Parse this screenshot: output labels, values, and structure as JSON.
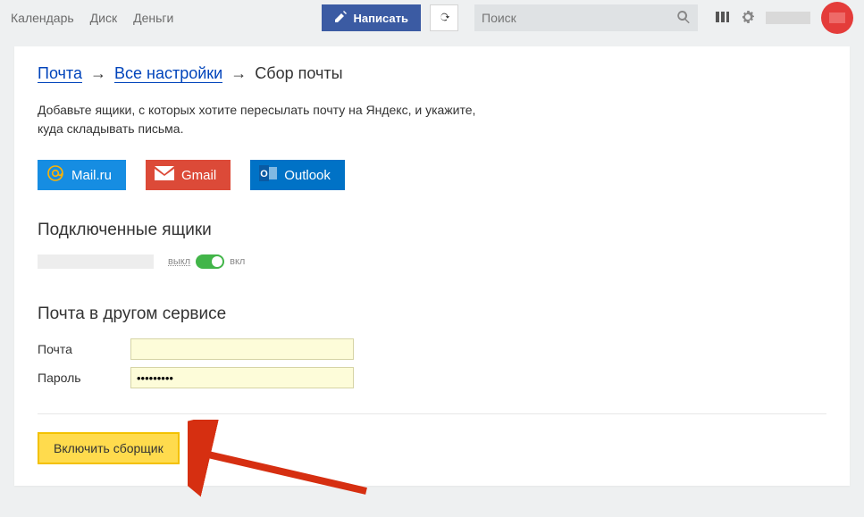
{
  "topbar": {
    "nav": [
      {
        "label": "Календарь"
      },
      {
        "label": "Диск"
      },
      {
        "label": "Деньги"
      }
    ],
    "compose_label": "Написать",
    "search_placeholder": "Поиск"
  },
  "breadcrumb": {
    "mail": "Почта",
    "arrow": "→",
    "all_settings": "Все настройки",
    "current": "Сбор почты"
  },
  "description": "Добавьте ящики, с которых хотите пересылать почту на Яндекс, и укажите,\nкуда складывать письма.",
  "providers": {
    "mailru": "Mail.ru",
    "gmail": "Gmail",
    "outlook": "Outlook"
  },
  "connected": {
    "title": "Подключенные ящики",
    "toggle_off": "выкл",
    "toggle_on": "вкл"
  },
  "other_service": {
    "title": "Почта в другом сервисе",
    "email_label": "Почта",
    "password_label": "Пароль",
    "password_value": "•••••••••"
  },
  "submit_label": "Включить сборщик"
}
